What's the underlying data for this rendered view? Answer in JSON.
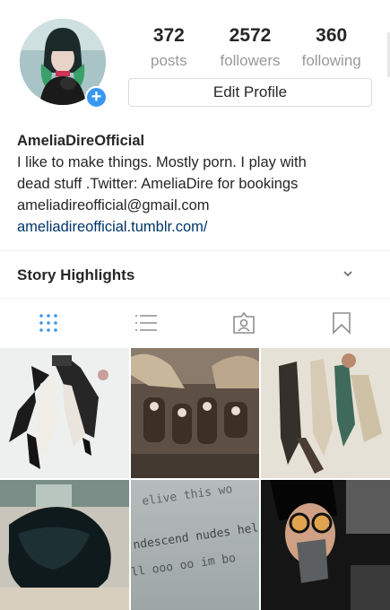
{
  "profile": {
    "stats": {
      "posts": {
        "count": "372",
        "label": "posts"
      },
      "followers": {
        "count": "2572",
        "label": "followers"
      },
      "following": {
        "count": "360",
        "label": "following"
      }
    },
    "edit_label": "Edit Profile",
    "add_icon": "plus-icon"
  },
  "bio": {
    "name": "AmeliaDireOfficial",
    "line1": "I like to make things. Mostly porn. I play with",
    "line2": "dead stuff .Twitter: AmeliaDire for bookings",
    "email": "ameliadireofficial@gmail.com",
    "link": "ameliadireofficial.tumblr.com/"
  },
  "highlights": {
    "label": "Story Highlights",
    "icon": "chevron-down-icon"
  },
  "tabs": [
    {
      "icon": "grid-icon",
      "active": true
    },
    {
      "icon": "list-icon",
      "active": false
    },
    {
      "icon": "tagged-icon",
      "active": false
    },
    {
      "icon": "saved-icon",
      "active": false
    }
  ],
  "grid": {
    "text_photo": {
      "line1": "elive this wo",
      "line2": "ndescend nudes hel",
      "line3": "ll   ooo oo im bo"
    }
  },
  "colors": {
    "accent": "#3897f0",
    "link": "#003569",
    "muted": "#999999"
  }
}
